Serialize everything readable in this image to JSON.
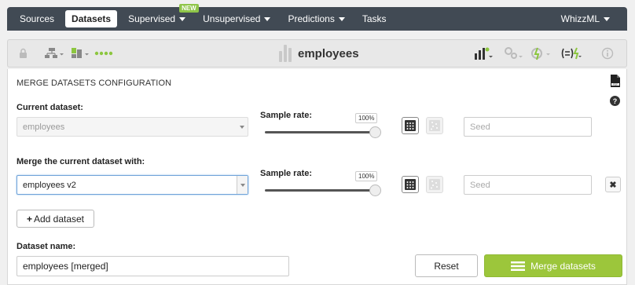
{
  "nav": {
    "items": [
      {
        "label": "Sources",
        "active": false,
        "caret": false
      },
      {
        "label": "Datasets",
        "active": true,
        "caret": false
      },
      {
        "label": "Supervised",
        "active": false,
        "caret": true
      },
      {
        "label": "Unsupervised",
        "active": false,
        "caret": true
      },
      {
        "label": "Predictions",
        "active": false,
        "caret": true
      },
      {
        "label": "Tasks",
        "active": false,
        "caret": false
      }
    ],
    "new_badge": "NEW",
    "user": "WhizzML"
  },
  "toolbar": {
    "title": "employees",
    "icons": [
      "lock-icon",
      "dataset-structure-icon",
      "configure-icon",
      "dots-icon",
      "model-icon",
      "cluster-icon",
      "scripts-icon",
      "formula-icon",
      "info-icon"
    ],
    "accent": "#8cc63f"
  },
  "form": {
    "section_title": "MERGE DATASETS CONFIGURATION",
    "current_dataset_label": "Current dataset:",
    "current_dataset_value": "employees",
    "sample_rate_label": "Sample rate:",
    "current_rate": "100%",
    "current_rate_value": 1.0,
    "seed_placeholder": "Seed",
    "merge_label": "Merge the current dataset with:",
    "merge_dataset_value": "employees v2",
    "merge_rate": "100%",
    "merge_rate_value": 1.0,
    "merge_seed_placeholder": "Seed",
    "remove_symbol": "✖",
    "add_dataset_label": "Add dataset",
    "add_symbol": "+",
    "dataset_name_label": "Dataset name:",
    "dataset_name_value": "employees [merged]",
    "reset_label": "Reset",
    "merge_button_label": "Merge datasets"
  },
  "colors": {
    "nav_bg": "#414a54",
    "primary_green": "#9cc63b",
    "new_badge": "#8fc549"
  }
}
